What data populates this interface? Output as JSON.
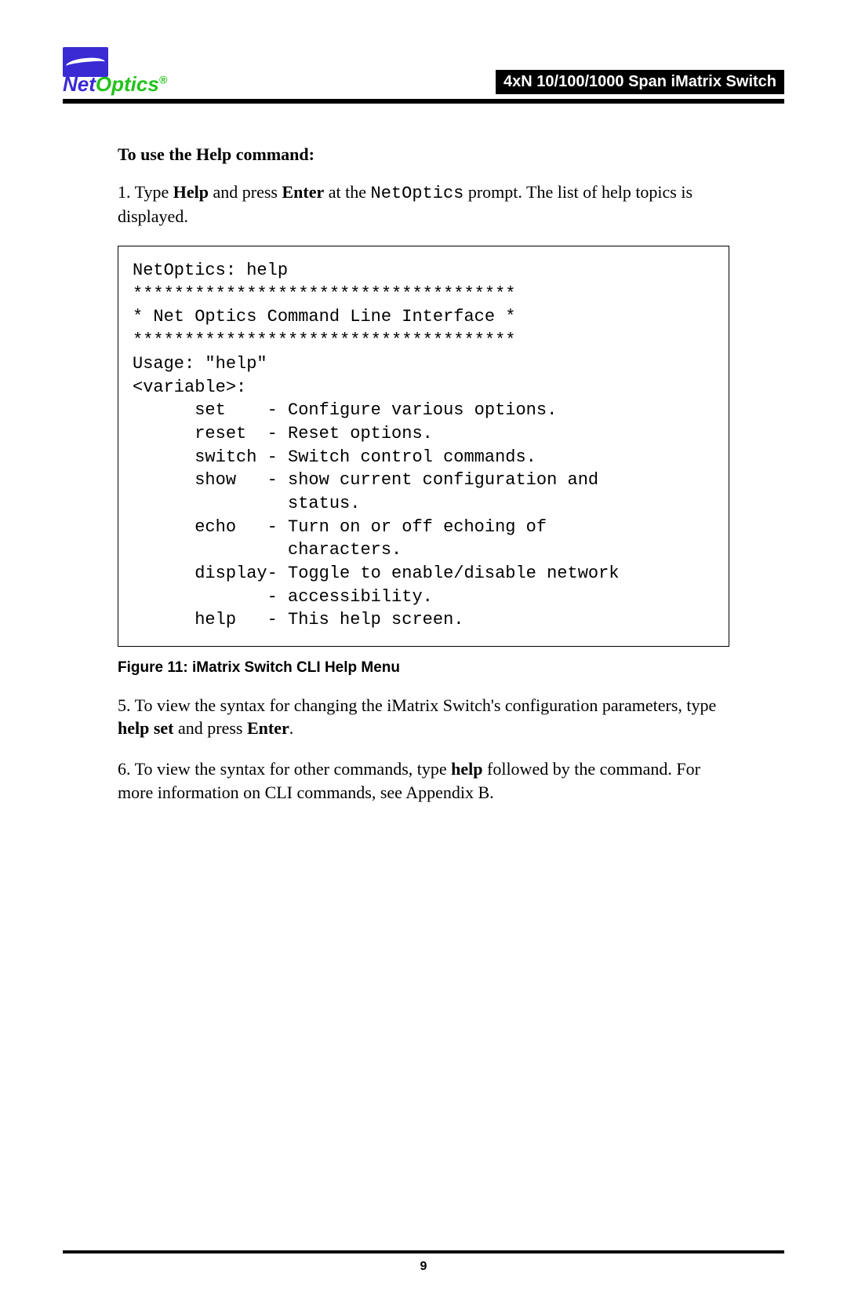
{
  "header": {
    "logo_net": "Net",
    "logo_optics": "Optics",
    "logo_reg": "®",
    "title": "4xN 10/100/1000 Span iMatrix Switch"
  },
  "section_heading": "To use the Help command:",
  "step1": {
    "num": "1.",
    "t1": "Type ",
    "b1": "Help",
    "t2": " and press ",
    "b2": "Enter",
    "t3": " at the ",
    "m1": "NetOptics",
    "t4": " prompt. The list of help topics is displayed."
  },
  "cli": "NetOptics: help\n*************************************\n* Net Optics Command Line Interface *\n*************************************\nUsage: \"help\"\n<variable>:\n      set    - Configure various options.\n      reset  - Reset options.\n      switch - Switch control commands.\n      show   - show current configuration and\n               status.\n      echo   - Turn on or off echoing of\n               characters.\n      display- Toggle to enable/disable network\n             - accessibility.\n      help   - This help screen.",
  "figure": {
    "label": "Figure 11:",
    "text": " iMatrix Switch CLI Help Menu"
  },
  "step5": {
    "num": "5.",
    "t1": "To view the syntax for changing the iMatrix Switch's configuration parameters, type ",
    "b1": "help set",
    "t2": " and press ",
    "b2": "Enter",
    "t3": "."
  },
  "step6": {
    "num": "6.",
    "t1": "To view the syntax for other commands, type ",
    "b1": "help",
    "t2": " followed by the command. For more information on CLI commands, see Appendix B."
  },
  "page_number": "9"
}
